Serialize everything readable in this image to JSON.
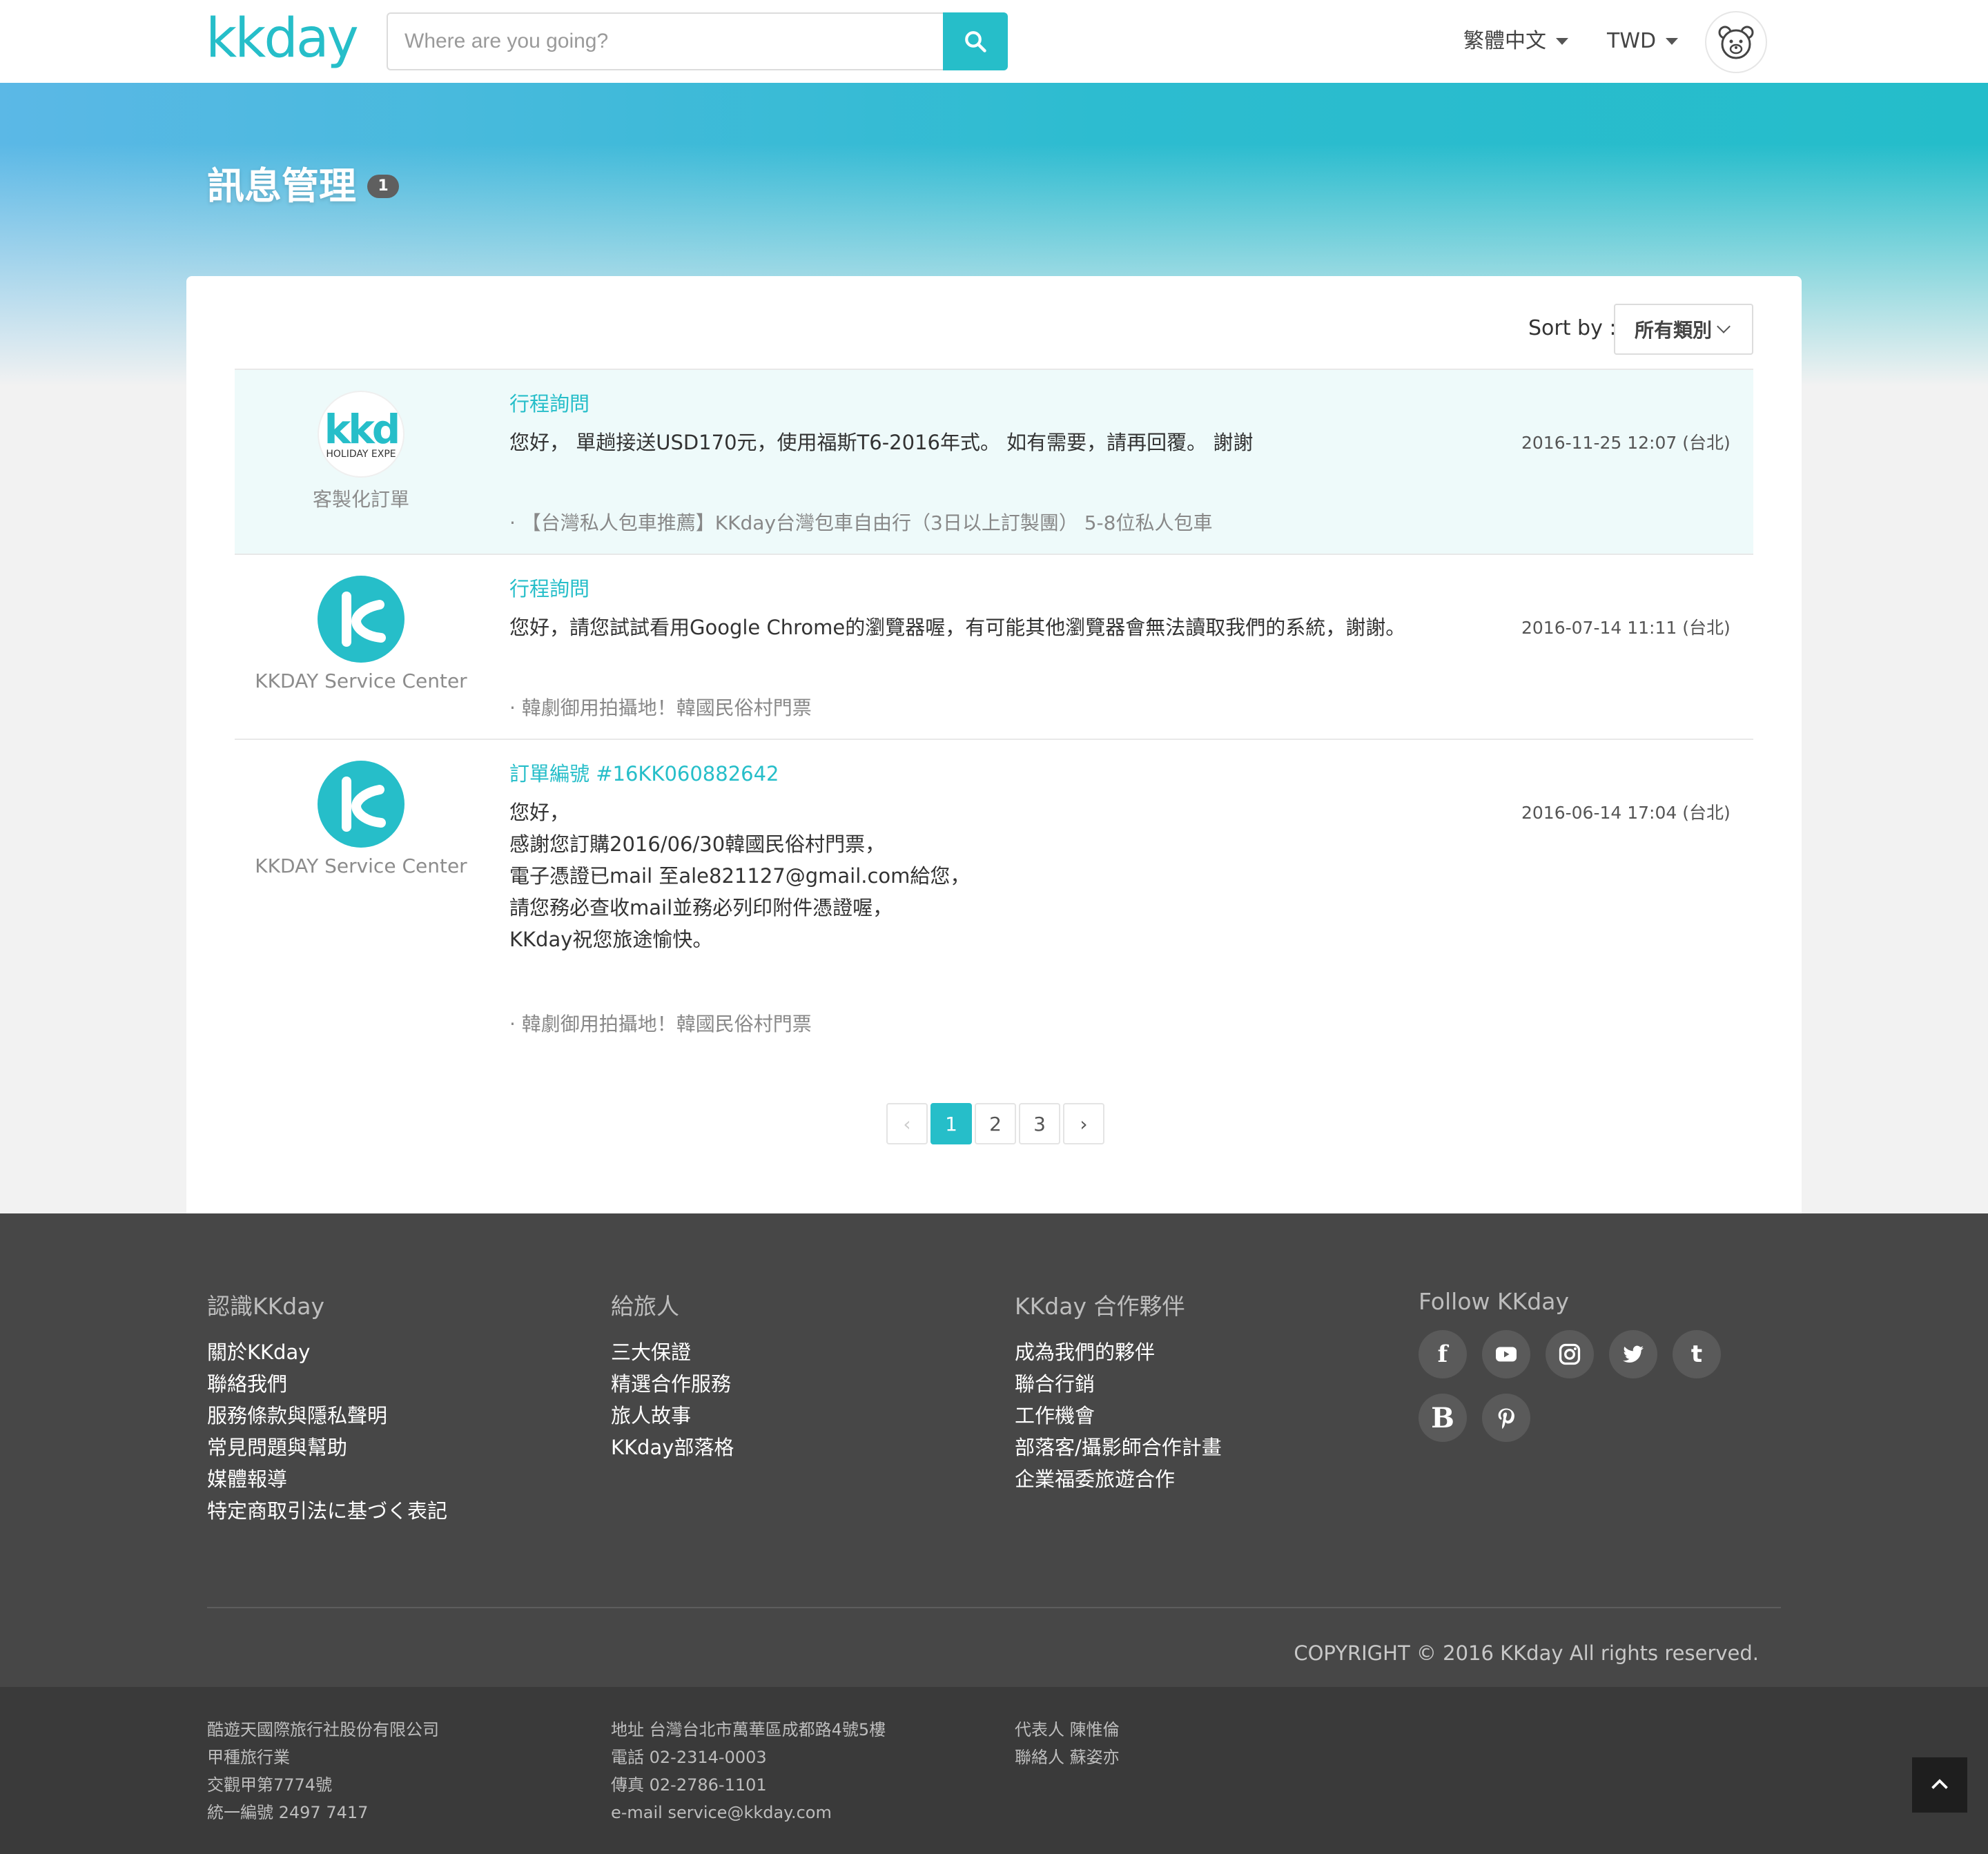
{
  "header": {
    "logo": "kkday",
    "search_placeholder": "Where are you going?",
    "language": "繁體中文",
    "currency": "TWD"
  },
  "page": {
    "title": "訊息管理",
    "badge": "1"
  },
  "sort": {
    "label": "Sort by :",
    "value": "所有類別"
  },
  "messages": [
    {
      "sender": "客製化訂單",
      "logo_text": "kkd",
      "logo_sub": "HOLIDAY EXPE",
      "subject": "行程詢問",
      "body": [
        "您好， 單趟接送USD170元，使用福斯T6-2016年式。 如有需要，請再回覆。 謝謝"
      ],
      "date": "2016-11-25 12:07 (台北)",
      "product": "· 【台灣私人包車推薦】KKday台灣包車自由行（3日以上訂製團） 5-8位私人包車"
    },
    {
      "sender": "KKDAY Service Center",
      "subject": "行程詢問",
      "body": [
        "您好，請您試試看用Google Chrome的瀏覽器喔，有可能其他瀏覽器會無法讀取我們的系統，謝謝。"
      ],
      "date": "2016-07-14 11:11 (台北)",
      "product": "· 韓劇御用拍攝地！韓國民俗村門票"
    },
    {
      "sender": "KKDAY Service Center",
      "subject": "訂單編號 #16KK060882642",
      "body": [
        "您好，",
        "感謝您訂購2016/06/30韓國民俗村門票，",
        "電子憑證已mail 至ale821127@gmail.com給您，",
        "請您務必查收mail並務必列印附件憑證喔，",
        "KKday祝您旅途愉快。"
      ],
      "date": "2016-06-14 17:04 (台北)",
      "product": "· 韓劇御用拍攝地！韓國民俗村門票"
    }
  ],
  "pagination": {
    "prev": "‹",
    "pages": [
      "1",
      "2",
      "3"
    ],
    "current": "1",
    "next": "›"
  },
  "footer": {
    "about": {
      "heading": "認識KKday",
      "links": [
        "關於KKday",
        "聯絡我們",
        "服務條款與隱私聲明",
        "常見問題與幫助",
        "媒體報導",
        "特定商取引法に基づく表記"
      ]
    },
    "travelers": {
      "heading": "給旅人",
      "links": [
        "三大保證",
        "精選合作服務",
        "旅人故事",
        "KKday部落格"
      ]
    },
    "partners": {
      "heading": "KKday 合作夥伴",
      "links": [
        "成為我們的夥伴",
        "聯合行銷",
        "工作機會",
        "部落客/攝影師合作計畫",
        "企業福委旅遊合作"
      ]
    },
    "follow": {
      "heading": "Follow KKday",
      "icons": [
        "facebook-icon",
        "youtube-icon",
        "instagram-icon",
        "twitter-icon",
        "tumblr-icon",
        "blogger-icon",
        "pinterest-icon"
      ]
    },
    "copyright": "COPYRIGHT © 2016 KKday All rights reserved."
  },
  "company": {
    "col1": [
      "酷遊天國際旅行社股份有限公司",
      "甲種旅行業",
      "交觀甲第7774號",
      "統一編號 2497 7417"
    ],
    "col2": [
      "地址 台灣台北市萬華區成都路4號5樓",
      "電話 02-2314-0003",
      "傳真 02-2786-1101",
      "e-mail service@kkday.com"
    ],
    "col3": [
      "代表人 陳惟倫",
      "聯絡人 蘇姿亦"
    ]
  },
  "colors": {
    "brand": "#26bec9",
    "footer_bg": "#474747",
    "subfooter_bg": "#3a3a3a",
    "highlight_row": "#eefafa"
  }
}
